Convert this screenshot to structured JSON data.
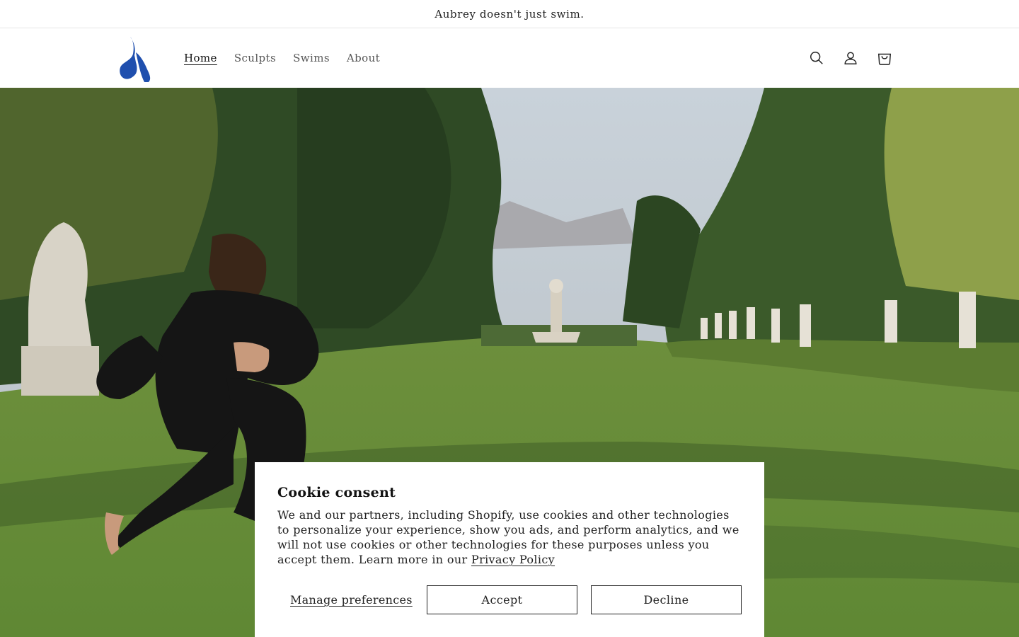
{
  "announcement": {
    "text": "Aubrey doesn't just swim."
  },
  "header": {
    "logo_color": "#1f4fae",
    "nav": [
      {
        "label": "Home",
        "active": true
      },
      {
        "label": "Sculpts",
        "active": false
      },
      {
        "label": "Swims",
        "active": false
      },
      {
        "label": "About",
        "active": false
      }
    ],
    "icons": [
      "search-icon",
      "account-icon",
      "cart-icon"
    ]
  },
  "hero": {
    "image": "woman-running-on-garden-lawn-photo"
  },
  "cookie_banner": {
    "title": "Cookie consent",
    "body": "We and our partners, including Shopify, use cookies and other technologies to personalize your experience, show you ads, and perform analytics, and we will not use cookies or other technologies for these purposes unless you accept them. Learn more in our ",
    "privacy_link": "Privacy Policy",
    "manage_label": "Manage preferences",
    "accept_label": "Accept",
    "decline_label": "Decline"
  }
}
